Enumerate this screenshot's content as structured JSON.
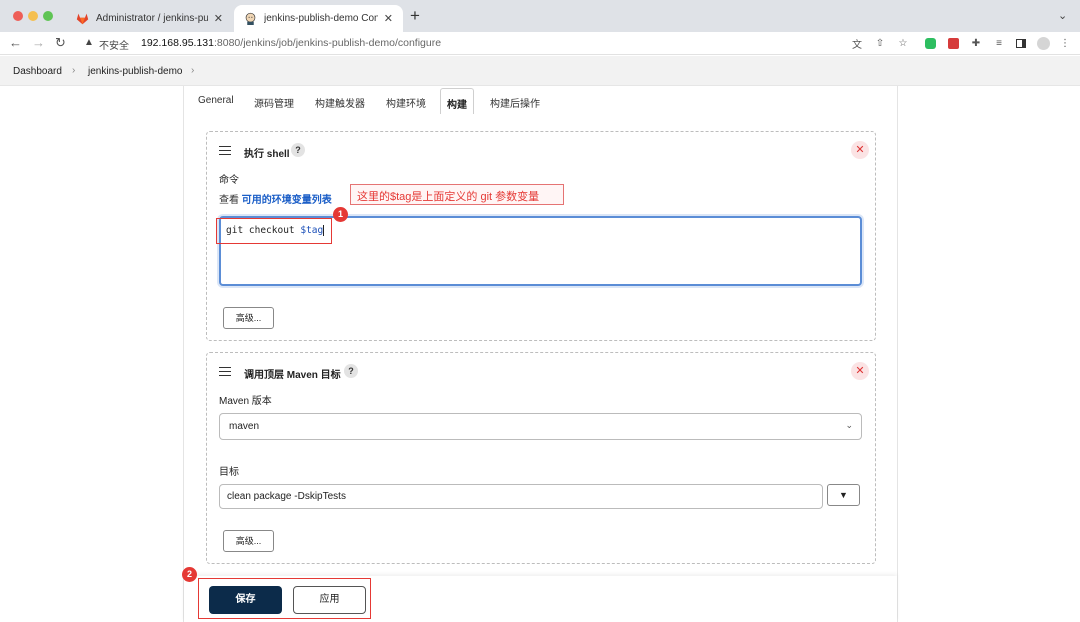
{
  "browser": {
    "tabs": [
      {
        "title": "Administrator / jenkins-publish",
        "icon": "gitlab-icon",
        "active": false
      },
      {
        "title": "jenkins-publish-demo Config [",
        "icon": "jenkins-icon",
        "active": true
      }
    ],
    "insecure_label": "不安全",
    "url_host": "192.168.95.131",
    "url_path": ":8080/jenkins/job/jenkins-publish-demo/configure"
  },
  "breadcrumb": {
    "items": [
      "Dashboard",
      "jenkins-publish-demo"
    ]
  },
  "config_tabs": [
    "General",
    "源码管理",
    "构建触发器",
    "构建环境",
    "构建",
    "构建后操作"
  ],
  "active_tab": "构建",
  "shell_step": {
    "title": "执行 shell",
    "command_label": "命令",
    "env_prefix": "查看",
    "env_link": "可用的环境变量列表",
    "code_plain": "git checkout ",
    "code_var": "$tag",
    "advanced_label": "高级..."
  },
  "maven_step": {
    "title": "调用顶层 Maven 目标",
    "version_label": "Maven 版本",
    "version_value": "maven",
    "goals_label": "目标",
    "goals_value": "clean package -DskipTests",
    "advanced_label": "高级..."
  },
  "actions": {
    "save": "保存",
    "apply": "应用"
  },
  "annotations": {
    "note": "这里的$tag是上面定义的 git 参数变量",
    "marker_1": "1",
    "marker_2": "2",
    "color": "#e53935"
  },
  "colors": {
    "save_button": "#0c2b4a",
    "link": "#1b5ec7"
  }
}
